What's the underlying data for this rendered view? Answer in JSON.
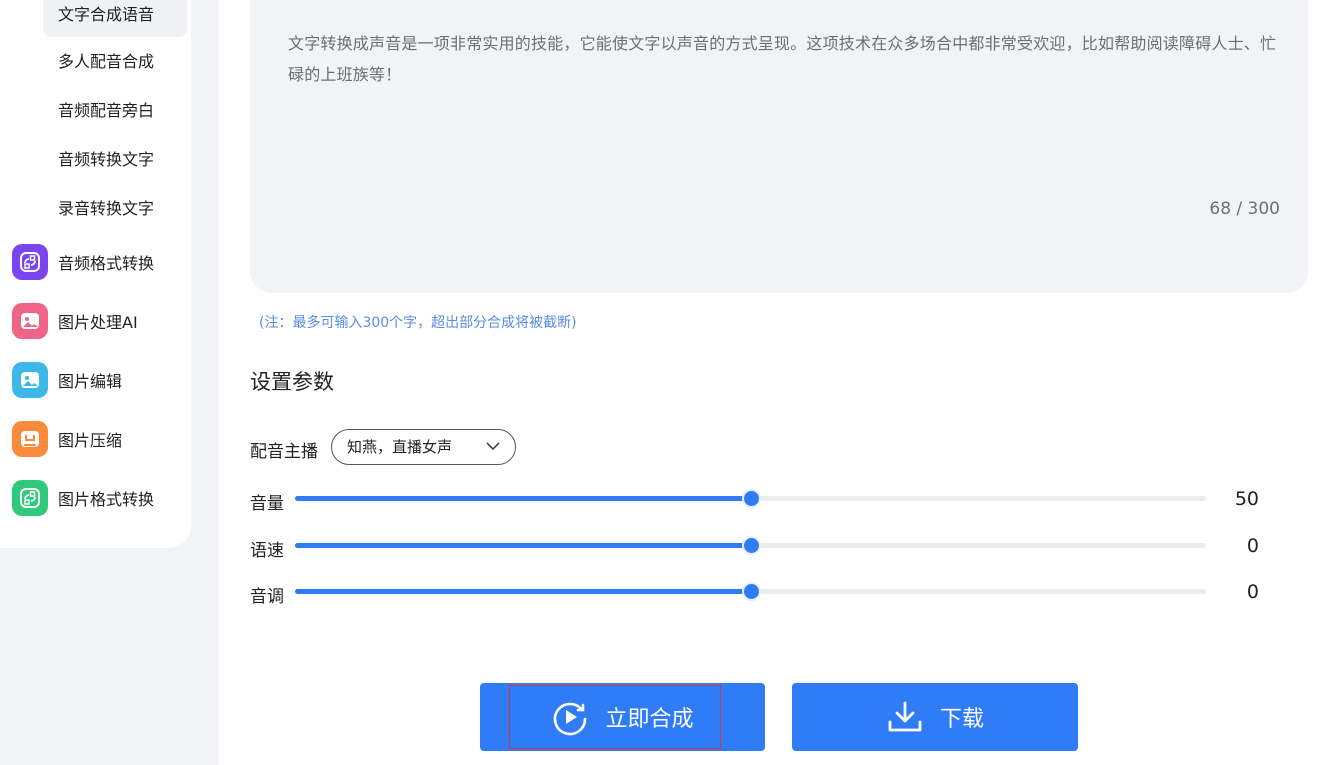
{
  "sidebar": {
    "sub_items": [
      {
        "label": "文字合成语音",
        "active": true
      },
      {
        "label": "多人配音合成",
        "active": false
      },
      {
        "label": "音频配音旁白",
        "active": false
      },
      {
        "label": "音频转换文字",
        "active": false
      },
      {
        "label": "录音转换文字",
        "active": false
      }
    ],
    "main_items": [
      {
        "label": "音频格式转换",
        "icon": "audio-convert-icon",
        "color": "#7a45f0"
      },
      {
        "label": "图片处理AI",
        "icon": "image-ai-icon",
        "color": "#f06488"
      },
      {
        "label": "图片编辑",
        "icon": "image-edit-icon",
        "color": "#3bb8e8"
      },
      {
        "label": "图片压缩",
        "icon": "image-compress-icon",
        "color": "#fb8a3c"
      },
      {
        "label": "图片格式转换",
        "icon": "image-convert-icon",
        "color": "#2ec97a"
      }
    ]
  },
  "editor": {
    "text": "文字转换成声音是一项非常实用的技能，它能使文字以声音的方式呈现。这项技术在众多场合中都非常受欢迎，比如帮助阅读障碍人士、忙碌的上班族等！",
    "char_count": "68 / 300",
    "note": "(注：最多可输入300个字，超出部分合成将被截断)"
  },
  "settings": {
    "title": "设置参数",
    "voice_label": "配音主播",
    "voice_value": "知燕，直播女声",
    "sliders": [
      {
        "label": "音量",
        "value": "50",
        "fraction": 0.5
      },
      {
        "label": "语速",
        "value": "0",
        "fraction": 0.5
      },
      {
        "label": "音调",
        "value": "0",
        "fraction": 0.5
      }
    ]
  },
  "actions": {
    "synthesize_label": "立即合成",
    "download_label": "下载"
  },
  "colors": {
    "accent": "#2f7cf6",
    "note": "#5a8ee0",
    "highlight_border": "#d8323a"
  }
}
